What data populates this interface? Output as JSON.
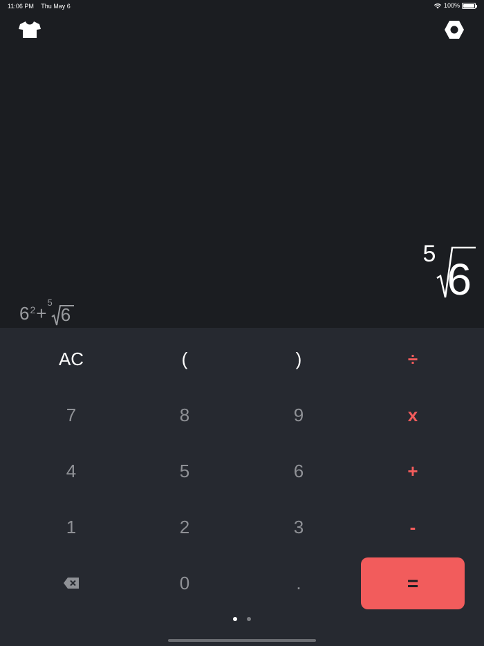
{
  "status_bar": {
    "time": "11:06 PM",
    "date": "Thu May 6",
    "battery": "100%"
  },
  "top_bar": {
    "theme_icon": "tshirt-icon",
    "settings_icon": "hexagon-settings-icon"
  },
  "display": {
    "result": {
      "root_index": "5",
      "radicand": "6"
    },
    "expression": {
      "base": "6",
      "exponent": "2",
      "operator": "+",
      "root_index": "5",
      "radicand": "6"
    }
  },
  "keypad": {
    "row1": [
      "AC",
      "(",
      ")",
      "÷"
    ],
    "row2": [
      "7",
      "8",
      "9",
      "x"
    ],
    "row3": [
      "4",
      "5",
      "6",
      "+"
    ],
    "row4": [
      "1",
      "2",
      "3",
      "-"
    ],
    "row5": [
      "0",
      ".",
      "="
    ],
    "backspace_icon": "backspace-icon"
  },
  "pager": {
    "pages": 2,
    "active": 1
  },
  "colors": {
    "background": "#1b1d21",
    "keypad_background": "#262930",
    "accent": "#f25c5c",
    "digit": "#8f9196"
  }
}
